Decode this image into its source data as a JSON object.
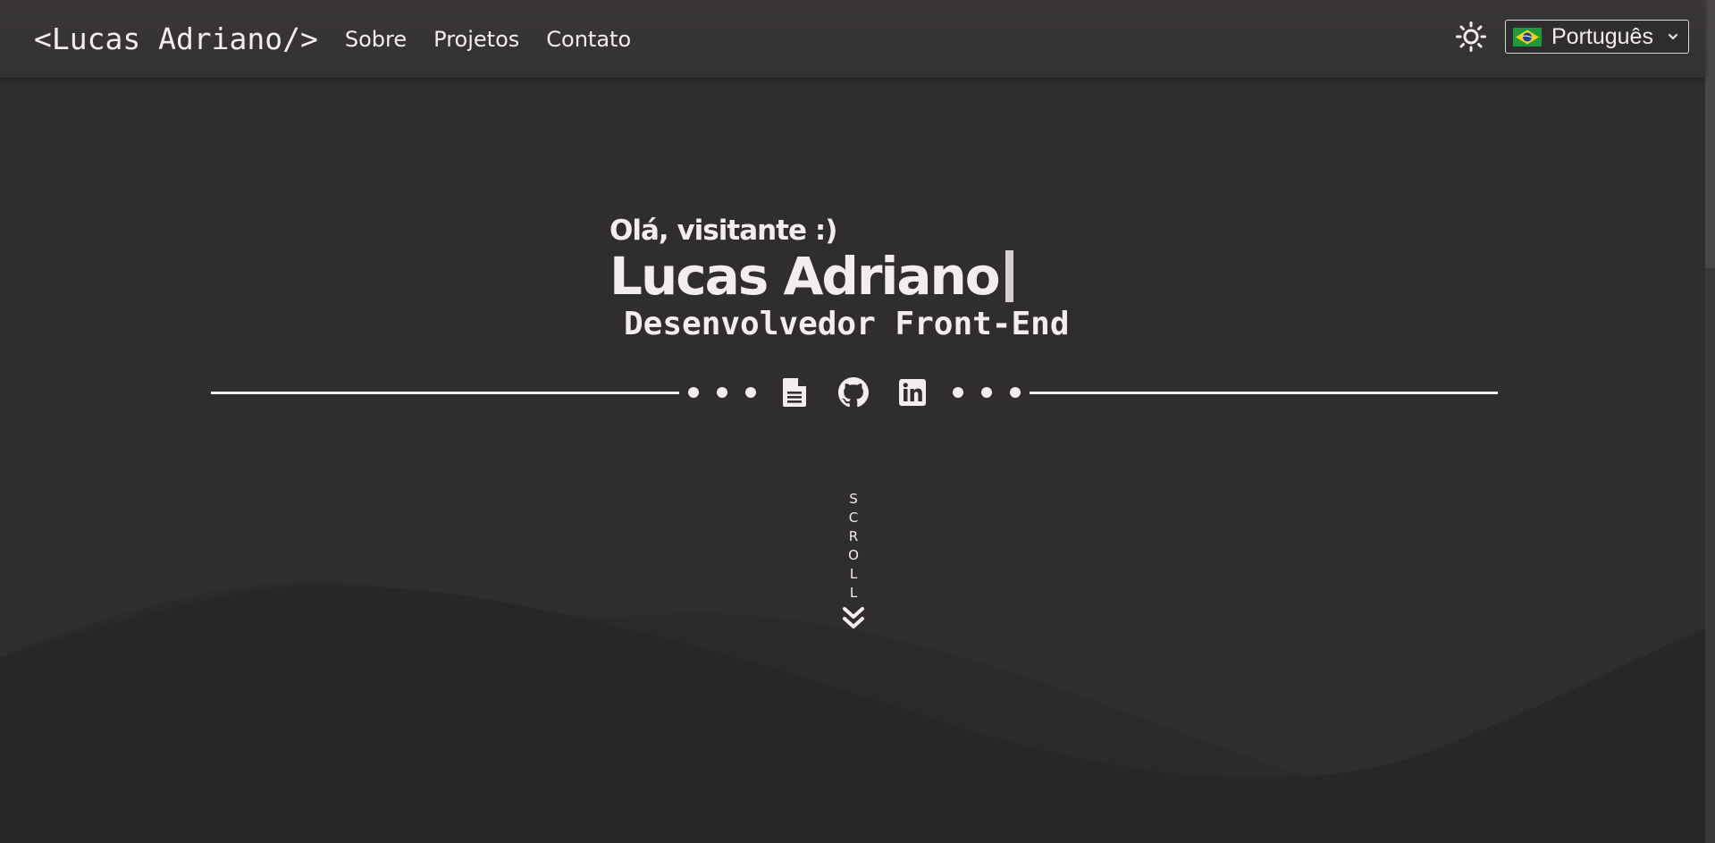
{
  "navbar": {
    "brand": "<Lucas Adriano/>",
    "links": [
      {
        "label": "Sobre"
      },
      {
        "label": "Projetos"
      },
      {
        "label": "Contato"
      }
    ],
    "theme_toggle_icon": "sun-icon",
    "language": {
      "selected": "Português",
      "flag_icon": "brazil-flag-icon",
      "dropdown_icon": "chevron-down-icon"
    }
  },
  "hero": {
    "greeting": "Olá, visitante :)",
    "name": "Lucas Adriano",
    "role": "Desenvolvedor Front-End"
  },
  "social": {
    "icons": [
      {
        "name": "resume-document-icon"
      },
      {
        "name": "github-icon"
      },
      {
        "name": "linkedin-icon"
      }
    ]
  },
  "scroll": {
    "letters": [
      "S",
      "C",
      "R",
      "O",
      "L",
      "L"
    ],
    "icon": "double-chevron-down-icon"
  },
  "colors": {
    "background": "#2f2d2e",
    "navbar": "#383535",
    "text": "#f3eeee",
    "wave_dark": "#282726",
    "wave_mid": "#2b2a29",
    "caret": "#d6d0d1"
  }
}
